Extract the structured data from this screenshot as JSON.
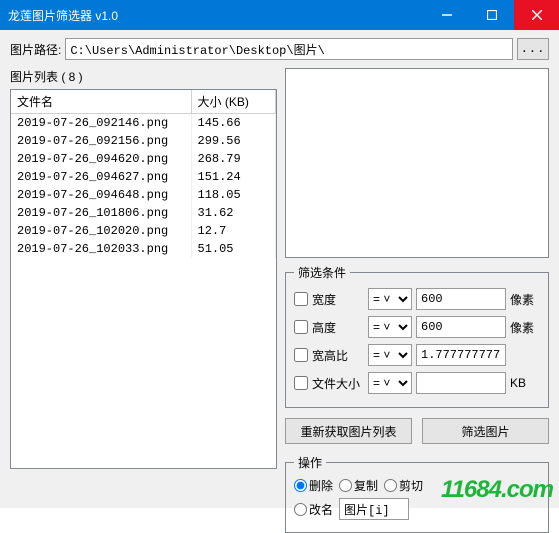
{
  "window": {
    "title": "龙莲图片筛选器 v1.0"
  },
  "path": {
    "label": "图片路径:",
    "value": "C:\\Users\\Administrator\\Desktop\\图片\\",
    "browse": "..."
  },
  "list": {
    "label": "图片列表 ( 8 )",
    "columns": {
      "name": "文件名",
      "size": "大小 (KB)"
    },
    "rows": [
      {
        "name": "2019-07-26_092146.png",
        "size": "145.66"
      },
      {
        "name": "2019-07-26_092156.png",
        "size": "299.56"
      },
      {
        "name": "2019-07-26_094620.png",
        "size": "268.79"
      },
      {
        "name": "2019-07-26_094627.png",
        "size": "151.24"
      },
      {
        "name": "2019-07-26_094648.png",
        "size": "118.05"
      },
      {
        "name": "2019-07-26_101806.png",
        "size": "31.62"
      },
      {
        "name": "2019-07-26_102020.png",
        "size": "12.7"
      },
      {
        "name": "2019-07-26_102033.png",
        "size": "51.05"
      }
    ]
  },
  "filters": {
    "legend": "筛选条件",
    "width": {
      "label": "宽度",
      "op": "= ˅",
      "value": "600",
      "unit": "像素"
    },
    "height": {
      "label": "高度",
      "op": "= ˅",
      "value": "600",
      "unit": "像素"
    },
    "ratio": {
      "label": "宽高比",
      "op": "= ˅",
      "value": "1.77777777777",
      "unit": ""
    },
    "fsize": {
      "label": "文件大小",
      "op": "= ˅",
      "value": "",
      "unit": "KB"
    }
  },
  "actions": {
    "reload": "重新获取图片列表",
    "filter": "筛选图片"
  },
  "ops": {
    "legend": "操作",
    "delete": "删除",
    "copy": "复制",
    "cut": "剪切",
    "rename": "改名",
    "rename_pattern": "图片[i]"
  },
  "watermark": "11684.com"
}
